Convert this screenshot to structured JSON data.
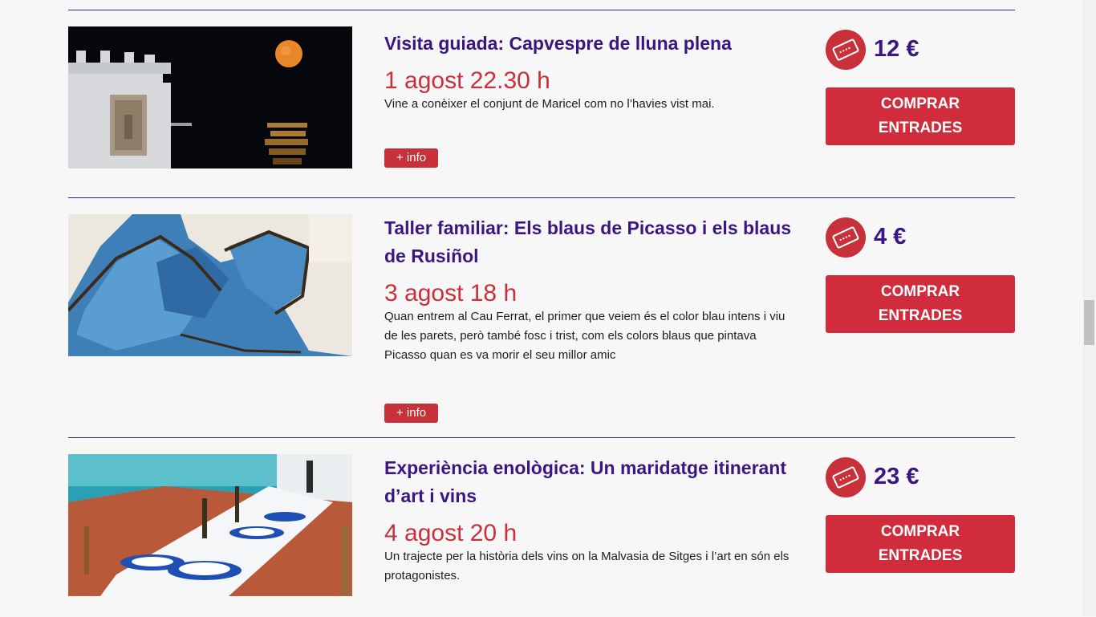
{
  "events": [
    {
      "title": "Visita guiada: Capvespre de lluna plena",
      "date": "1 agost 22.30 h",
      "description": "Vine a conèixer el conjunt de Maricel com no l’havies vist mai.",
      "info_label": "+ info",
      "price": "12 €",
      "buy_line1": "COMPRAR",
      "buy_line2": "ENTRADES"
    },
    {
      "title": "Taller familiar: Els blaus de Picasso i els blaus de Rusiñol",
      "date": "3 agost 18 h",
      "description": "Quan entrem al Cau Ferrat, el primer que veiem és el color blau intens i viu de les parets, però també fosc i trist, com els colors blaus que pintava Picasso quan es va morir el seu millor amic",
      "info_label": "+ info",
      "price": "4 €",
      "buy_line1": "COMPRAR",
      "buy_line2": "ENTRADES"
    },
    {
      "title": "Experiència enològica: Un maridatge itinerant d’art i vins",
      "date": "4 agost 20 h",
      "description": "Un trajecte per la història dels vins on la Malvasia de Sitges i l’art en són els protagonistes.",
      "price": "23 €",
      "buy_line1": "COMPRAR",
      "buy_line2": "ENTRADES"
    }
  ],
  "icons": {
    "ticket": "ticket-icon"
  },
  "colors": {
    "accent_red": "#d02c3c",
    "title_purple": "#3b1682",
    "divider": "#3a1f80"
  }
}
